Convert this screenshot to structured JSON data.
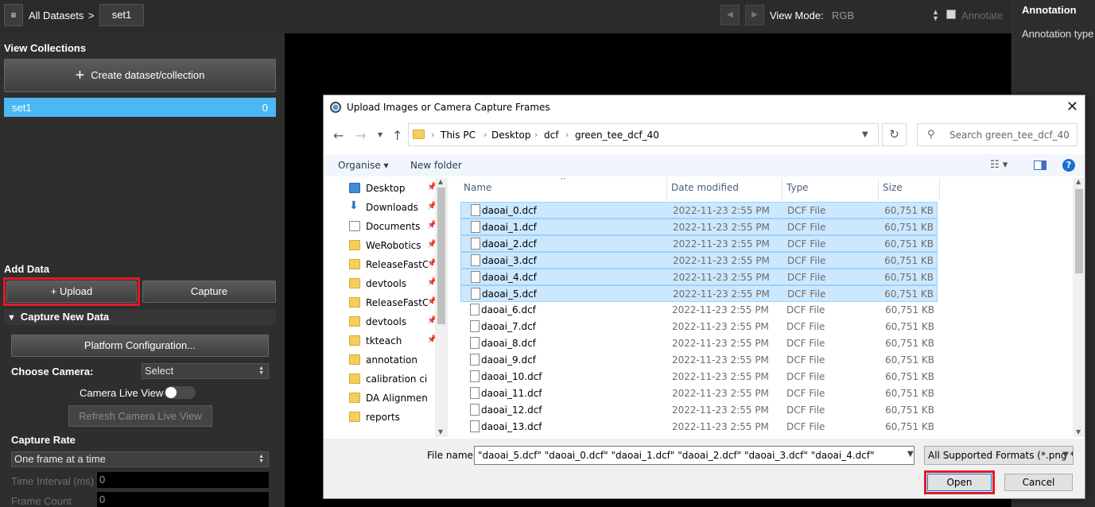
{
  "topbar": {
    "menu_icon": "≡",
    "crumb_all": "All Datasets",
    "crumb_sep": ">",
    "crumb_current": "set1",
    "prev_icon": "◀",
    "next_icon": "▶",
    "view_mode_label": "View Mode:",
    "view_mode_value": "RGB",
    "annotate_label": "Annotate",
    "annotate_checked": false
  },
  "right_panel": {
    "title": "Annotation",
    "type_label": "Annotation type"
  },
  "left_panel": {
    "collections_heading": "View Collections",
    "create_label": "Create dataset/collection",
    "create_icon": "+",
    "datasets": [
      {
        "name": "set1",
        "count": "0"
      }
    ],
    "add_data_heading": "Add Data",
    "upload_label": "+  Upload",
    "capture_label": "Capture",
    "capture_section": "Capture New Data",
    "capture_section_icon": "▼",
    "platform_label": "Platform Configuration...",
    "camera_label": "Choose Camera:",
    "camera_value": "Select",
    "live_view_label": "Camera Live View",
    "live_view_on": false,
    "refresh_label": "Refresh Camera Live View",
    "rate_label": "Capture Rate",
    "rate_value": "One frame at a time",
    "interval_label": "Time Interval (ms)",
    "interval_value": "0",
    "frame_count_label": "Frame Count",
    "frame_count_value": "0"
  },
  "dialog": {
    "title": "Upload Images or Camera Capture Frames",
    "close_icon": "✕",
    "path": [
      "This PC",
      "Desktop",
      "dcf",
      "green_tee_dcf_40"
    ],
    "search_placeholder": "Search green_tee_dcf_40",
    "organise_label": "Organise ▾",
    "new_folder_label": "New folder",
    "nav_items": [
      {
        "label": "Desktop",
        "icon": "desktop-icon",
        "pinned": true
      },
      {
        "label": "Downloads",
        "icon": "download-icon",
        "pinned": true
      },
      {
        "label": "Documents",
        "icon": "document-icon",
        "pinned": true
      },
      {
        "label": "WeRobotics",
        "icon": "folder-icon",
        "pinned": true
      },
      {
        "label": "ReleaseFastCa",
        "icon": "folder-icon",
        "pinned": true
      },
      {
        "label": "devtools",
        "icon": "folder-icon",
        "pinned": true
      },
      {
        "label": "ReleaseFastCa",
        "icon": "folder-icon",
        "pinned": true
      },
      {
        "label": "devtools",
        "icon": "folder-icon",
        "pinned": true
      },
      {
        "label": "tkteach",
        "icon": "folder-icon",
        "pinned": true
      },
      {
        "label": "annotation",
        "icon": "folder-icon",
        "pinned": false
      },
      {
        "label": "calibration circle",
        "icon": "folder-icon",
        "pinned": false
      },
      {
        "label": "DA Alignment T",
        "icon": "folder-icon",
        "pinned": false
      },
      {
        "label": "reports",
        "icon": "folder-icon",
        "pinned": false
      }
    ],
    "columns": {
      "name": "Name",
      "date": "Date modified",
      "type": "Type",
      "size": "Size"
    },
    "files": [
      {
        "name": "daoai_0.dcf",
        "date": "2022-11-23 2:55 PM",
        "type": "DCF File",
        "size": "60,751 KB",
        "selected": true
      },
      {
        "name": "daoai_1.dcf",
        "date": "2022-11-23 2:55 PM",
        "type": "DCF File",
        "size": "60,751 KB",
        "selected": true
      },
      {
        "name": "daoai_2.dcf",
        "date": "2022-11-23 2:55 PM",
        "type": "DCF File",
        "size": "60,751 KB",
        "selected": true
      },
      {
        "name": "daoai_3.dcf",
        "date": "2022-11-23 2:55 PM",
        "type": "DCF File",
        "size": "60,751 KB",
        "selected": true
      },
      {
        "name": "daoai_4.dcf",
        "date": "2022-11-23 2:55 PM",
        "type": "DCF File",
        "size": "60,751 KB",
        "selected": true
      },
      {
        "name": "daoai_5.dcf",
        "date": "2022-11-23 2:55 PM",
        "type": "DCF File",
        "size": "60,751 KB",
        "selected": true
      },
      {
        "name": "daoai_6.dcf",
        "date": "2022-11-23 2:55 PM",
        "type": "DCF File",
        "size": "60,751 KB",
        "selected": false
      },
      {
        "name": "daoai_7.dcf",
        "date": "2022-11-23 2:55 PM",
        "type": "DCF File",
        "size": "60,751 KB",
        "selected": false
      },
      {
        "name": "daoai_8.dcf",
        "date": "2022-11-23 2:55 PM",
        "type": "DCF File",
        "size": "60,751 KB",
        "selected": false
      },
      {
        "name": "daoai_9.dcf",
        "date": "2022-11-23 2:55 PM",
        "type": "DCF File",
        "size": "60,751 KB",
        "selected": false
      },
      {
        "name": "daoai_10.dcf",
        "date": "2022-11-23 2:55 PM",
        "type": "DCF File",
        "size": "60,751 KB",
        "selected": false
      },
      {
        "name": "daoai_11.dcf",
        "date": "2022-11-23 2:55 PM",
        "type": "DCF File",
        "size": "60,751 KB",
        "selected": false
      },
      {
        "name": "daoai_12.dcf",
        "date": "2022-11-23 2:55 PM",
        "type": "DCF File",
        "size": "60,751 KB",
        "selected": false
      },
      {
        "name": "daoai_13.dcf",
        "date": "2022-11-23 2:55 PM",
        "type": "DCF File",
        "size": "60,751 KB",
        "selected": false
      }
    ],
    "file_name_label": "File name:",
    "file_name_value": "\"daoai_5.dcf\" \"daoai_0.dcf\" \"daoai_1.dcf\" \"daoai_2.dcf\" \"daoai_3.dcf\" \"daoai_4.dcf\"",
    "format_value": "All Supported Formats (*.png *.",
    "open_label": "Open",
    "cancel_label": "Cancel"
  }
}
